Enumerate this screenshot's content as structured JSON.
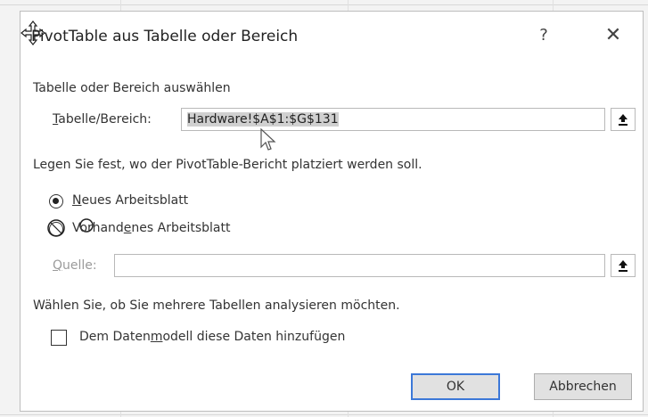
{
  "dialog": {
    "title": "PivotTable aus Tabelle oder Bereich",
    "help_label": "?",
    "close_label": "✕"
  },
  "section_select": {
    "heading": "Tabelle oder Bereich auswählen",
    "range_label_u": "T",
    "range_label_rest": "abelle/Bereich:",
    "range_value": "Hardware!$A$1:$G$131"
  },
  "section_place": {
    "heading": "Legen Sie fest, wo der PivotTable-Bericht platziert werden soll.",
    "option_new_u": "N",
    "option_new_rest": "eues Arbeitsblatt",
    "option_existing_pre": "Vorhand",
    "option_existing_u": "e",
    "option_existing_rest": "nes Arbeitsblatt",
    "source_label_u": "Q",
    "source_label_rest": "uelle:",
    "source_value": ""
  },
  "section_multi": {
    "heading": "Wählen Sie, ob Sie mehrere Tabellen analysieren möchten.",
    "checkbox_pre": "Dem Daten",
    "checkbox_u": "m",
    "checkbox_rest": "odell diese Daten hinzufügen"
  },
  "buttons": {
    "ok_label": "OK",
    "cancel_label": "Abbrechen"
  },
  "state": {
    "new_worksheet_selected": true,
    "data_model_checked": false
  }
}
